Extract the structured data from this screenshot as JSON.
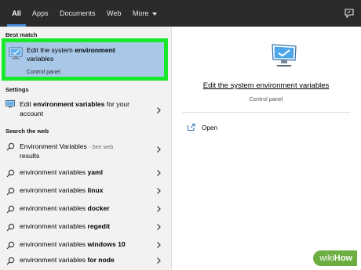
{
  "topbar": {
    "tabs": [
      {
        "label": "All",
        "active": true
      },
      {
        "label": "Apps"
      },
      {
        "label": "Documents"
      },
      {
        "label": "Web"
      },
      {
        "label": "More"
      }
    ]
  },
  "left": {
    "best_match_header": "Best match",
    "best_match": {
      "title_plain": "Edit the system ",
      "title_bold": "environment",
      "title_rest": "variables",
      "subtitle": "Control panel"
    },
    "settings_header": "Settings",
    "settings_item": {
      "pre": "Edit ",
      "bold": "environment variables",
      "post": " for your account"
    },
    "web_header": "Search the web",
    "web_items": [
      {
        "plain": "Environment Variables",
        "bold": "",
        "suffix": " - See web",
        "suffix2": "results"
      },
      {
        "plain": "environment variables ",
        "bold": "yaml"
      },
      {
        "plain": "environment variables ",
        "bold": "linux"
      },
      {
        "plain": "environment variables ",
        "bold": "docker"
      },
      {
        "plain": "environment variables ",
        "bold": "regedit"
      },
      {
        "plain": "environment variables ",
        "bold": "windows 10"
      },
      {
        "plain": "environment variables ",
        "bold": "for node"
      }
    ]
  },
  "right": {
    "title": "Edit the system environment variables",
    "subtitle": "Control panel",
    "open_label": "Open"
  },
  "watermark": {
    "part1": "wiki",
    "part2": "How"
  },
  "colors": {
    "topbar": "#2b2b2b",
    "tab_underline": "#4a8fe0",
    "left_pane": "#f2f2f2",
    "selection": "#a9c8e8",
    "highlight_border": "#17e82a",
    "watermark": "#6cae41"
  }
}
